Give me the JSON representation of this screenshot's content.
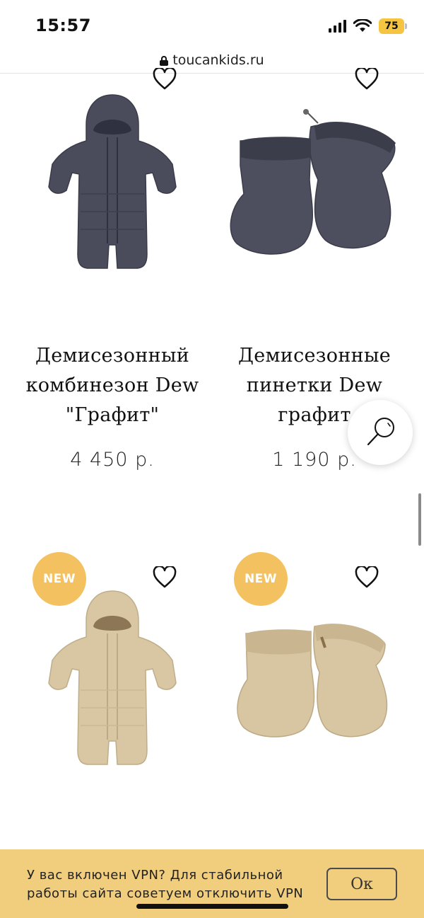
{
  "status_bar": {
    "time": "15:57",
    "battery": "75",
    "icons": [
      "signal-icon",
      "wifi-icon",
      "battery-icon"
    ]
  },
  "browser": {
    "url": "toucankids.ru",
    "lock_icon": "lock-icon"
  },
  "products": [
    {
      "title_lines": [
        "Демисезонный",
        "комбинезон Dew",
        "\"Графит\""
      ],
      "price": "4 450 р.",
      "color": "#4a4c5c",
      "icon": "heart-icon"
    },
    {
      "title_lines": [
        "Демисезонные",
        "пинетки Dew",
        "графит"
      ],
      "price": "1 190 р.",
      "color": "#4a4c5c",
      "icon": "heart-icon"
    },
    {
      "badge": "NEW",
      "color": "#d9c7a3",
      "icon": "heart-icon"
    },
    {
      "badge": "NEW",
      "color": "#d9c7a3",
      "icon": "heart-icon"
    }
  ],
  "search_button": {
    "icon": "search-icon"
  },
  "vpn_banner": {
    "line1": "У вас включен VPN? Для стабильной",
    "line2": "работы сайта советуем отключить VPN",
    "ok_label": "Ок",
    "background": "#f1cd7e"
  },
  "colors": {
    "badge": "#f4c160",
    "text": "#111111"
  }
}
